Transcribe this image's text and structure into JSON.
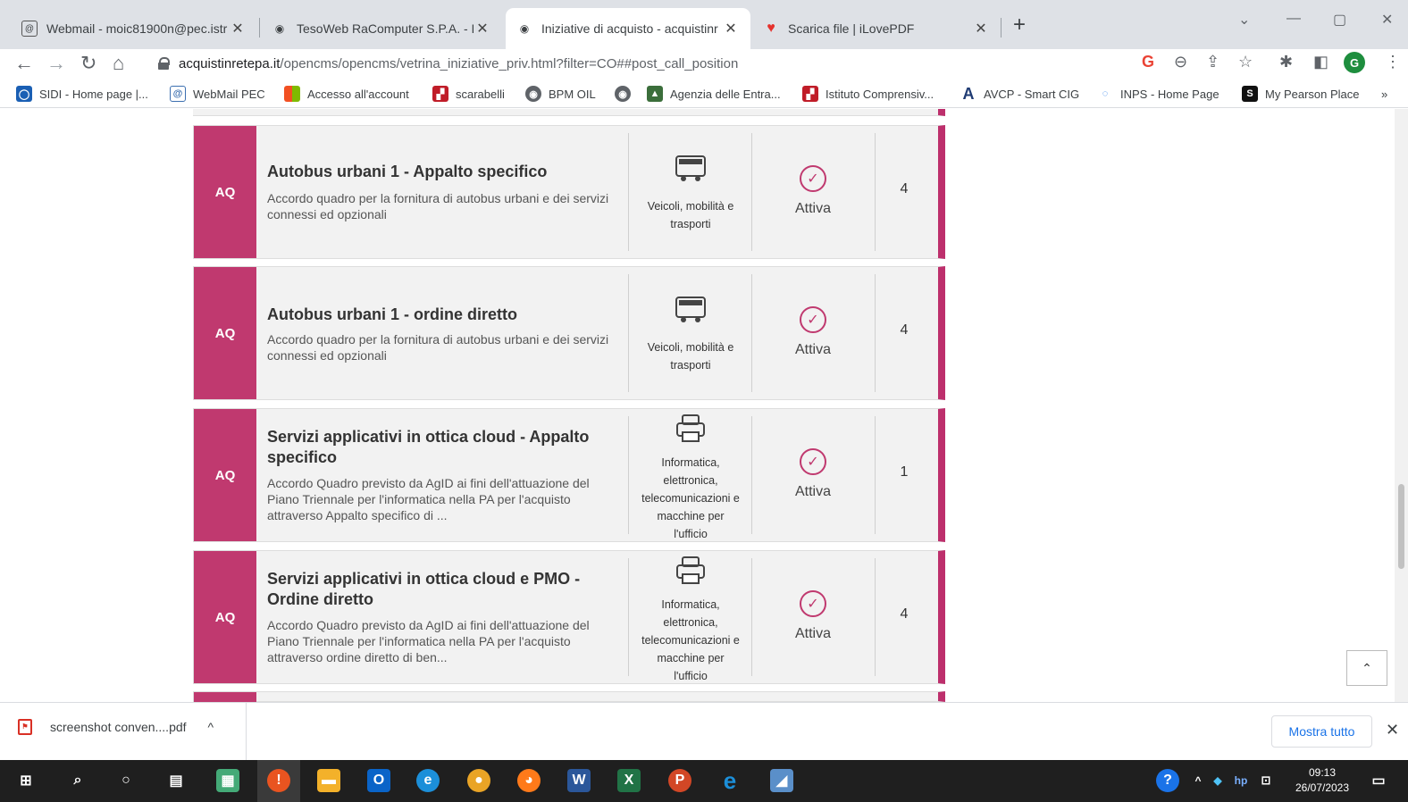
{
  "browser": {
    "tabs": [
      {
        "title": "Webmail - moic81900n@pec.istr",
        "icon": "webmail-icon"
      },
      {
        "title": "TesoWeb RaComputer S.P.A. - Bi",
        "icon": "globe-icon"
      },
      {
        "title": "Iniziative di acquisto - acquistinr",
        "icon": "globe-icon",
        "active": true
      },
      {
        "title": "Scarica file | iLovePDF",
        "icon": "heart-icon"
      }
    ],
    "close_glyph": "✕",
    "new_tab_glyph": "+",
    "url_host": "acquistinretepa.it",
    "url_path": "/opencms/opencms/vetrina_iniziative_priv.html?filter=CO##post_call_position",
    "profile_initial": "G",
    "bookmarks": [
      {
        "label": "SIDI - Home page |...",
        "color": "#1a5fb4",
        "glyph": "◯"
      },
      {
        "label": "WebMail PEC",
        "color": "#3c6fb0",
        "glyph": "@"
      },
      {
        "label": "Accesso all'account",
        "color": "#f25022",
        "glyph": "■"
      },
      {
        "label": "scarabelli",
        "color": "#c01c28",
        "glyph": "▞"
      },
      {
        "label": "BPM OIL",
        "color": "#5f6368",
        "glyph": "◉"
      },
      {
        "label": "",
        "color": "#5f6368",
        "glyph": "◉"
      },
      {
        "label": "Agenzia delle Entra...",
        "color": "#3b6e3b",
        "glyph": "▲"
      },
      {
        "label": "Istituto Comprensiv...",
        "color": "#c01c28",
        "glyph": "▞"
      },
      {
        "label": "AVCP - Smart CIG",
        "color": "#1f3b73",
        "glyph": "A"
      },
      {
        "label": "INPS - Home Page",
        "color": "#1a73e8",
        "glyph": "◌"
      },
      {
        "label": "My Pearson Place",
        "color": "#111111",
        "glyph": "S"
      }
    ],
    "bookmarks_more": "»"
  },
  "cards": [
    {
      "tag": "AQ",
      "title": "Autobus urbani 1 - Appalto specifico",
      "description": "Accordo quadro per la fornitura di autobus urbani e dei servizi connessi ed opzionali",
      "category_lines": [
        "Veicoli, mobilità e",
        "trasporti"
      ],
      "category_icon": "bus-icon",
      "status": "Attiva",
      "count": "4"
    },
    {
      "tag": "AQ",
      "title": "Autobus urbani 1 - ordine diretto",
      "description": "Accordo quadro per la fornitura di autobus urbani e dei servizi connessi ed opzionali",
      "category_lines": [
        "Veicoli, mobilità e",
        "trasporti"
      ],
      "category_icon": "bus-icon",
      "status": "Attiva",
      "count": "4"
    },
    {
      "tag": "AQ",
      "title": "Servizi applicativi in ottica cloud - Appalto specifico",
      "description": "Accordo Quadro previsto da AgID ai fini dell'attuazione del Piano Triennale per l'informatica nella PA per l'acquisto attraverso Appalto specifico di ...",
      "category_lines": [
        "Informatica,",
        "elettronica,",
        "telecomunicazioni e",
        "macchine per",
        "l'ufficio"
      ],
      "category_icon": "printer-icon",
      "status": "Attiva",
      "count": "1"
    },
    {
      "tag": "AQ",
      "title": "Servizi applicativi in ottica cloud e PMO - Ordine diretto",
      "description": "Accordo Quadro previsto da AgID ai fini dell'attuazione del Piano Triennale per l'informatica nella PA per l'acquisto attraverso ordine diretto di ben...",
      "category_lines": [
        "Informatica,",
        "elettronica,",
        "telecomunicazioni e",
        "macchine per",
        "l'ufficio"
      ],
      "category_icon": "printer-icon",
      "status": "Attiva",
      "count": "4"
    }
  ],
  "back_to_top_glyph": "⌃",
  "download": {
    "filename": "screenshot conven....pdf",
    "caret": "^",
    "show_all": "Mostra tutto",
    "close": "✕"
  },
  "taskbar": {
    "time": "09:13",
    "date": "26/07/2023"
  },
  "colors": {
    "accent": "#c0396f",
    "card_bg": "#f2f2f2"
  }
}
